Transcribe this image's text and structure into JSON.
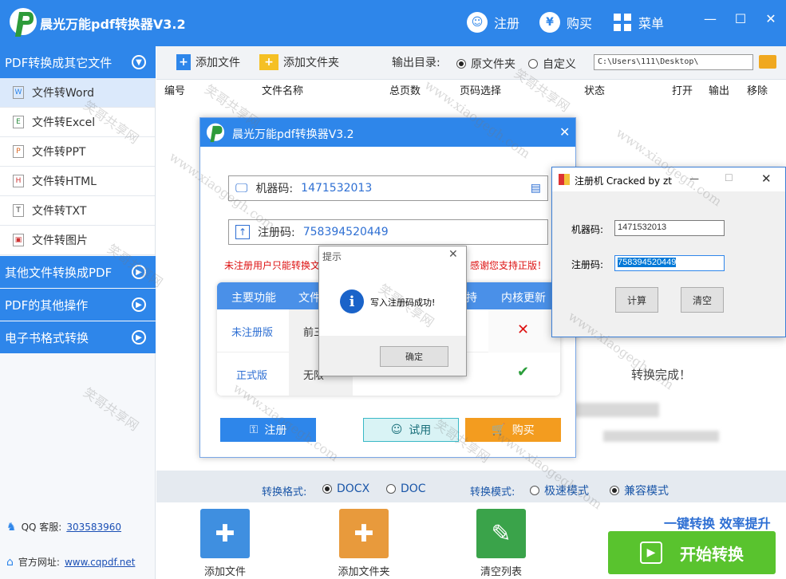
{
  "app": {
    "title": "晨光万能pdf转换器V3.2"
  },
  "titlebar": {
    "register": "注册",
    "buy": "购买",
    "menu": "菜单",
    "register_glyph": "☺",
    "buy_glyph": "¥"
  },
  "sidebar": {
    "groups": [
      {
        "label": "PDF转换成其它文件"
      },
      {
        "label": "其他文件转换成PDF"
      },
      {
        "label": "PDF的其他操作"
      },
      {
        "label": "电子书格式转换"
      }
    ],
    "items": [
      {
        "label": "文件转Word",
        "icon": "W"
      },
      {
        "label": "文件转Excel",
        "icon": "E"
      },
      {
        "label": "文件转PPT",
        "icon": "P"
      },
      {
        "label": "文件转HTML",
        "icon": "H"
      },
      {
        "label": "文件转TXT",
        "icon": "T"
      },
      {
        "label": "文件转图片",
        "icon": "▣"
      }
    ],
    "qq_label": "QQ 客服:",
    "qq": "303583960",
    "site_label": "官方网址:",
    "site": "www.cqpdf.net"
  },
  "toolbar": {
    "add_file": "添加文件",
    "add_folder": "添加文件夹",
    "output_label": "输出目录:",
    "opt_source": "原文件夹",
    "opt_custom": "自定义",
    "path": "C:\\Users\\111\\Desktop\\"
  },
  "table": {
    "headers": [
      "编号",
      "文件名称",
      "总页数",
      "页码选择",
      "状态",
      "打开",
      "输出",
      "移除"
    ]
  },
  "status": {
    "done": "转换完成！"
  },
  "options": {
    "format_label": "转换格式:",
    "docx": "DOCX",
    "doc": "DOC",
    "mode_label": "转换模式:",
    "fast": "极速模式",
    "compat": "兼容模式"
  },
  "bottom": {
    "add_file": "添加文件",
    "add_folder": "添加文件夹",
    "clear": "清空列表",
    "slogan": "一键转换  效率提升",
    "start": "开始转换"
  },
  "reg_dialog": {
    "title": "晨光万能pdf转换器V3.2",
    "machine_label": "机器码:",
    "machine": "1471532013",
    "code_label": "注册码:",
    "code": "758394520449",
    "warning_left": "未注册用户只能转换文",
    "warning_right": "感谢您支持正版！",
    "feat_headers": [
      "主要功能",
      "文件",
      "持",
      "内核更新"
    ],
    "row1_label": "未注册版",
    "row1_cell": "前三",
    "row2_label": "正式版",
    "row2_cell": "无限",
    "cross": "✕",
    "check": "✔",
    "btn_register": "注册",
    "btn_trial": "试用",
    "btn_buy": "购买"
  },
  "msgbox": {
    "title": "提示",
    "message": "写入注册码成功!",
    "ok": "确定"
  },
  "keygen": {
    "title": "注册机 Cracked by zt",
    "machine_label": "机器码:",
    "machine": "1471532013",
    "code_label": "注册码:",
    "code": "758394520449",
    "calc": "计算",
    "clear": "清空"
  },
  "watermark": {
    "text1": "笑哥共享网",
    "text2": "www.xiaogegh.com"
  }
}
